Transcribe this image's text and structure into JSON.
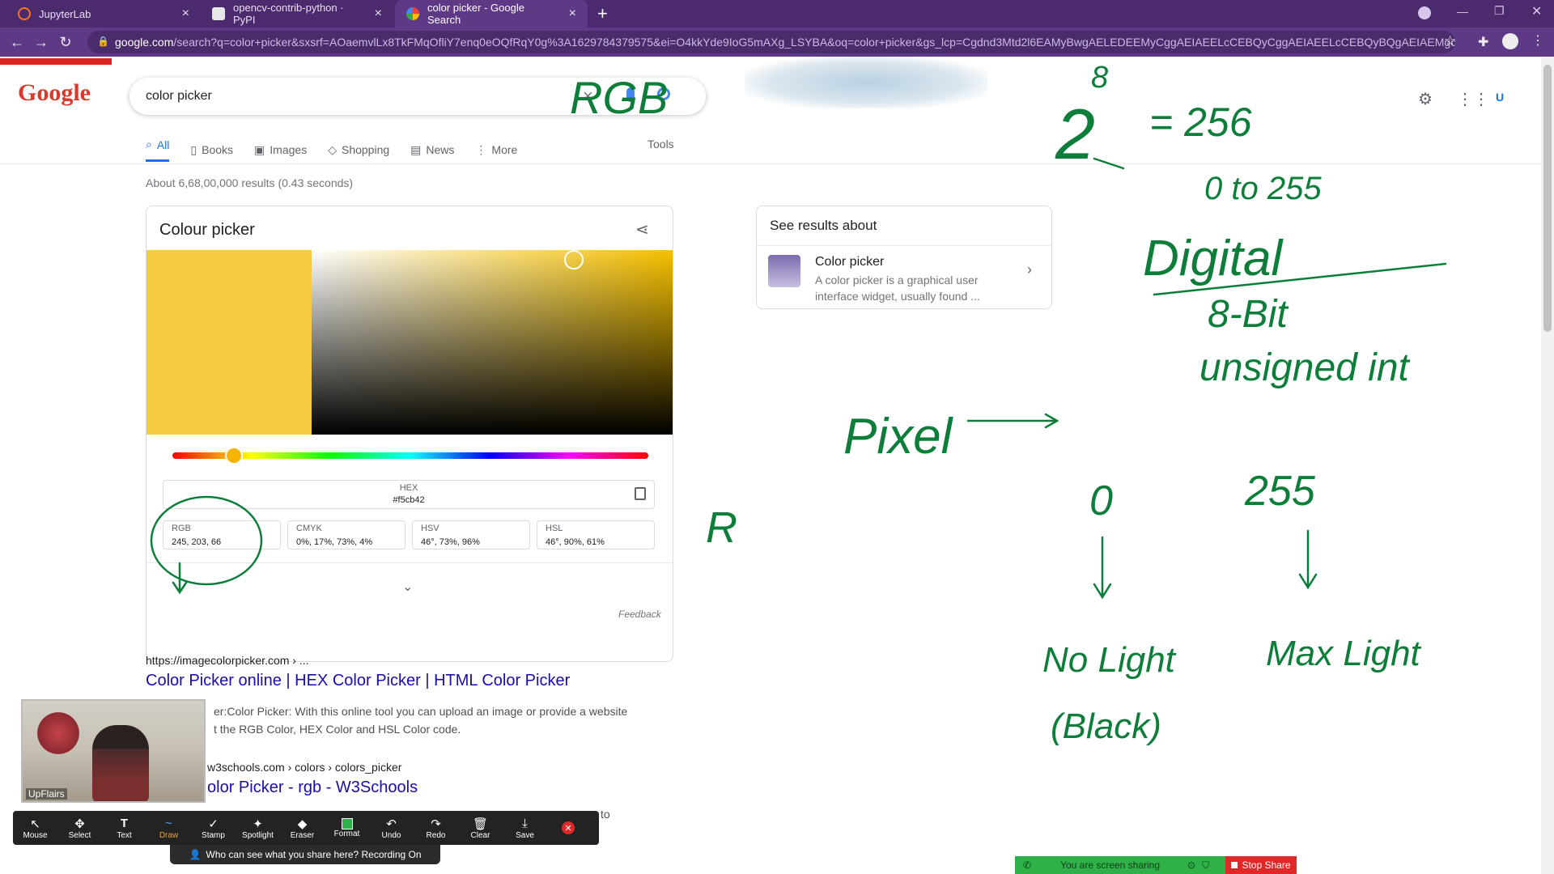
{
  "browser": {
    "tabs": [
      {
        "title": "JupyterLab",
        "active": false
      },
      {
        "title": "opencv-contrib-python · PyPI",
        "active": false
      },
      {
        "title": "color picker - Google Search",
        "active": true
      }
    ],
    "url_host": "google.com",
    "url_rest": "/search?q=color+picker&sxsrf=AOaemvlLx8TkFMqOfliY7enq0eOQfRqY0g%3A1629784379575&ei=O4kkYde9IoG5mAXg_LSYBA&oq=color+picker&gs_lcp=Cgdnd3Mtd2l6EAMyBwgAELEDEEMyCggAEIAEELcCEBQyCggAEIAEELcCEBQyBQgAEIAEMgcIABC..."
  },
  "google": {
    "logo_text": "Google",
    "search_value": "color picker",
    "nav_tabs": [
      "All",
      "Books",
      "Images",
      "Shopping",
      "News",
      "More"
    ],
    "tools": "Tools",
    "stats": "About 6,68,00,000 results (0.43 seconds)"
  },
  "picker": {
    "title": "Colour picker",
    "hex_label": "HEX",
    "hex_value": "#f5cb42",
    "swatch_color": "#f5cb42",
    "hue_fraction": 0.13,
    "fields": [
      {
        "label": "RGB",
        "value": "245, 203, 66"
      },
      {
        "label": "CMYK",
        "value": "0%, 17%, 73%, 4%"
      },
      {
        "label": "HSV",
        "value": "46°, 73%, 96%"
      },
      {
        "label": "HSL",
        "value": "46°, 90%, 61%"
      }
    ],
    "feedback": "Feedback"
  },
  "about": {
    "heading": "See results about",
    "title": "Color picker",
    "snippet_1": "A color picker is a graphical user",
    "snippet_2": "interface widget, usually found ..."
  },
  "results": [
    {
      "url": "https://imagecolorpicker.com › ...",
      "title": "Color Picker online | HEX Color Picker | HTML Color Picker",
      "snippet_1": "er:Color Picker: With this online tool you can upload an image or provide a website",
      "snippet_2": "t the RGB Color, HEX Color and HSL Color code."
    },
    {
      "url": "w3schools.com › colors › colors_picker",
      "title": "olor Picker - rgb - W3Schools",
      "snippet_1": "to"
    }
  ],
  "zoom": {
    "tools": [
      "Mouse",
      "Select",
      "Text",
      "Draw",
      "Stamp",
      "Spotlight",
      "Eraser",
      "Format",
      "Undo",
      "Redo",
      "Clear",
      "Save"
    ],
    "recording": "Who can see what you share here? Recording On",
    "sharing": "You are screen sharing",
    "stop_share": "Stop Share",
    "camera_name": "UpFlairs"
  },
  "annotations": {
    "rgb": "RGB",
    "two": "2",
    "eight": "8",
    "equals_256": "= 256",
    "range": "0 to 255",
    "digital": "Digital",
    "bit": "8-Bit",
    "unsigned": "unsigned int",
    "pixel": "Pixel",
    "zero": "0",
    "max": "255",
    "r": "R",
    "no_light": "No Light",
    "black": "(Black)",
    "max_light": "Max Light"
  },
  "colors": {
    "accent": "#1a73e8",
    "link": "#1a0dab",
    "ink": "#0d7d3a",
    "browser": "#5e3a86"
  }
}
